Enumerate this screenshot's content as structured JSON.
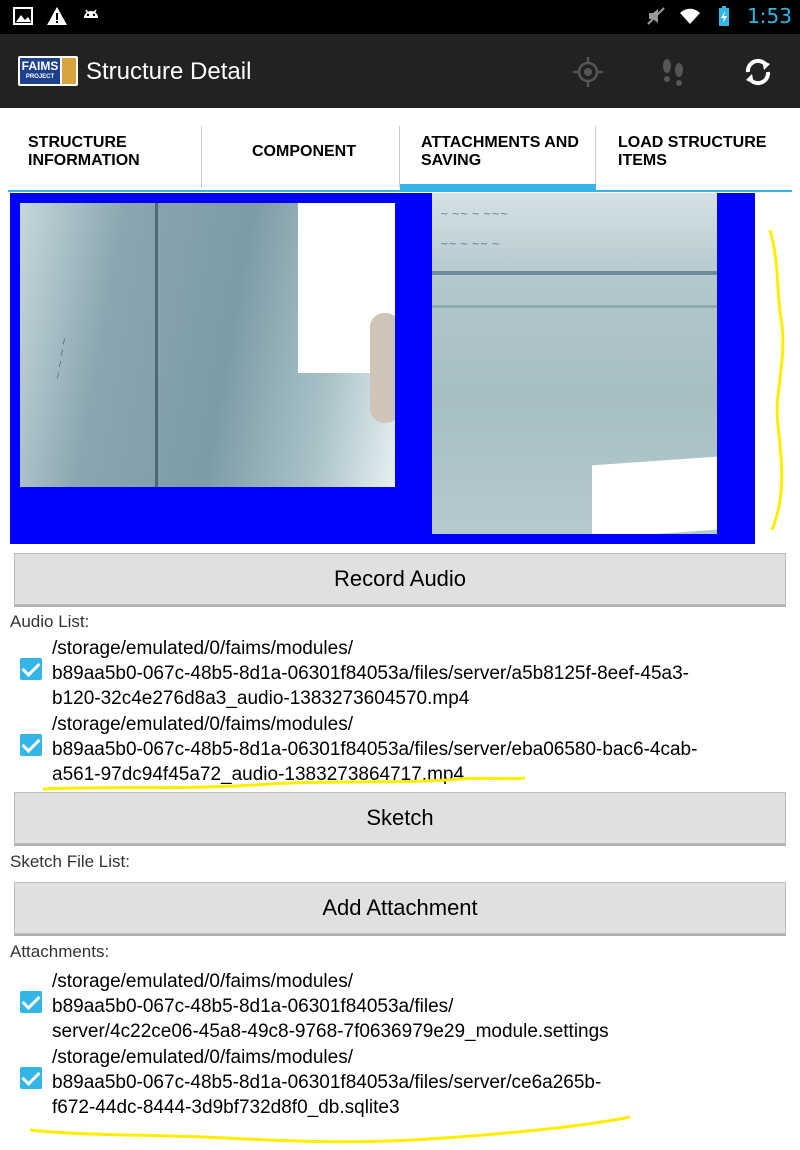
{
  "status": {
    "time": "1:53"
  },
  "app": {
    "title": "Structure Detail",
    "logo_text": "FAIMS",
    "logo_sub": "PROJECT"
  },
  "tabs": [
    {
      "label": "STRUCTURE INFORMATION"
    },
    {
      "label": "COMPONENT"
    },
    {
      "label": "ATTACHMENTS AND SAVING"
    },
    {
      "label": "LOAD STRUCTURE ITEMS"
    }
  ],
  "buttons": {
    "record_audio": "Record Audio",
    "sketch": "Sketch",
    "add_attachment": "Add Attachment"
  },
  "audio": {
    "label": "Audio List:",
    "items": [
      {
        "path": "/storage/emulated/0/faims/modules/\nb89aa5b0-067c-48b5-8d1a-06301f84053a/files/server/a5b8125f-8eef-45a3-\nb120-32c4e276d8a3_audio-1383273604570.mp4",
        "checked": true
      },
      {
        "path": "/storage/emulated/0/faims/modules/\nb89aa5b0-067c-48b5-8d1a-06301f84053a/files/server/eba06580-bac6-4cab-\na561-97dc94f45a72_audio-1383273864717.mp4",
        "checked": true
      }
    ]
  },
  "sketch": {
    "label": "Sketch File List:"
  },
  "attachments": {
    "label": "Attachments:",
    "items": [
      {
        "path": "/storage/emulated/0/faims/modules/\nb89aa5b0-067c-48b5-8d1a-06301f84053a/files/\nserver/4c22ce06-45a8-49c8-9768-7f0636979e29_module.settings",
        "checked": true
      },
      {
        "path": "/storage/emulated/0/faims/modules/\nb89aa5b0-067c-48b5-8d1a-06301f84053a/files/server/ce6a265b-\nf672-44dc-8444-3d9bf732d8f0_db.sqlite3",
        "checked": true
      }
    ]
  },
  "colors": {
    "accent": "#33b5e5",
    "gallery_bg": "#0000ff",
    "annotation": "#ffee00"
  },
  "icons": [
    "image-icon",
    "warning-icon",
    "android-icon",
    "mute-icon",
    "wifi-icon",
    "battery-icon",
    "gps-icon",
    "footsteps-icon",
    "sync-icon"
  ]
}
